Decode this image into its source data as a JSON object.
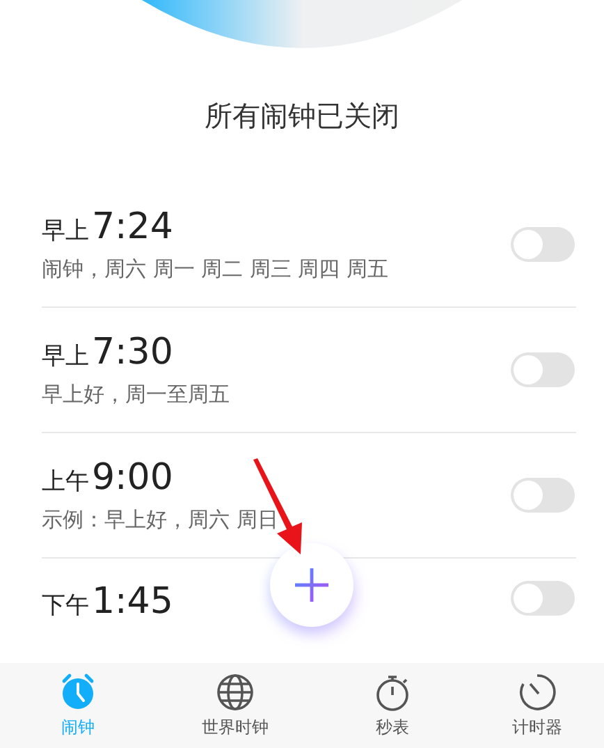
{
  "header": {
    "title": "所有闹钟已关闭"
  },
  "alarms": [
    {
      "period": "早上",
      "time": "7:24",
      "detail": "闹钟，周六 周一 周二 周三 周四 周五",
      "on": false
    },
    {
      "period": "早上",
      "time": "7:30",
      "detail": "早上好，周一至周五",
      "on": false
    },
    {
      "period": "上午",
      "time": "9:00",
      "detail": "示例：早上好，周六 周日",
      "on": false
    },
    {
      "period": "下午",
      "time": "1:45",
      "on": false
    }
  ],
  "tabs": [
    {
      "label": "闹钟",
      "selected": true
    },
    {
      "label": "世界时钟",
      "selected": false
    },
    {
      "label": "秒表",
      "selected": false
    },
    {
      "label": "计时器",
      "selected": false
    }
  ]
}
